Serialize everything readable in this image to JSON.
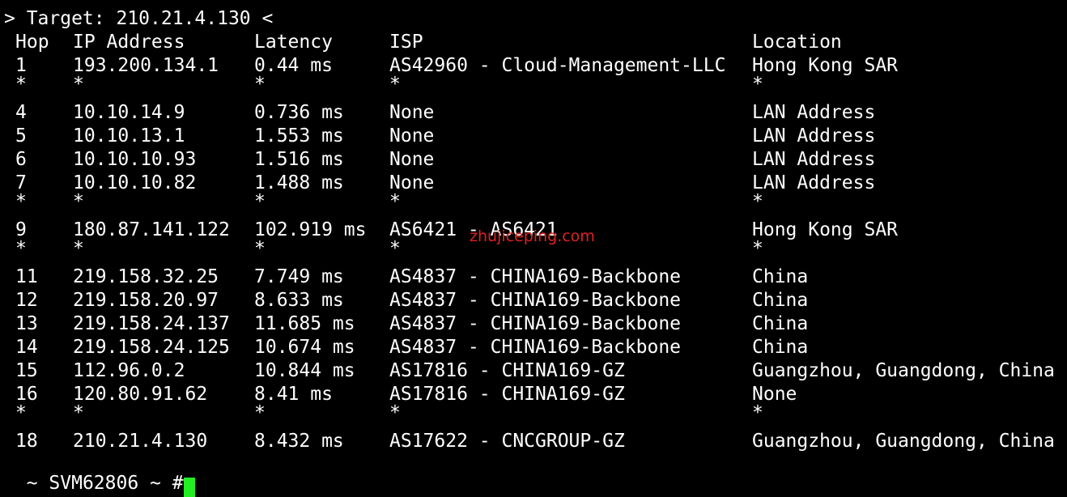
{
  "terminal": {
    "target_line": "> Target: 210.21.4.130 <",
    "headers": {
      "hop": "Hop",
      "ip": "IP Address",
      "latency": "Latency",
      "isp": "ISP",
      "location": "Location"
    },
    "rows": [
      {
        "hop": "1",
        "ip": "193.200.134.1",
        "latency": "0.44 ms",
        "isp": "AS42960 - Cloud-Management-LLC",
        "location": "Hong Kong SAR"
      },
      {
        "hop": "*",
        "ip": "*",
        "latency": "*",
        "isp": "*",
        "location": "*"
      },
      {
        "hop": "4",
        "ip": "10.10.14.9",
        "latency": "0.736 ms",
        "isp": "None",
        "location": "LAN Address"
      },
      {
        "hop": "5",
        "ip": "10.10.13.1",
        "latency": "1.553 ms",
        "isp": "None",
        "location": "LAN Address"
      },
      {
        "hop": "6",
        "ip": "10.10.10.93",
        "latency": "1.516 ms",
        "isp": "None",
        "location": "LAN Address"
      },
      {
        "hop": "7",
        "ip": "10.10.10.82",
        "latency": "1.488 ms",
        "isp": "None",
        "location": "LAN Address"
      },
      {
        "hop": "*",
        "ip": "*",
        "latency": "*",
        "isp": "*",
        "location": "*"
      },
      {
        "hop": "9",
        "ip": "180.87.141.122",
        "latency": "102.919 ms",
        "isp": "AS6421 - AS6421",
        "location": "Hong Kong SAR"
      },
      {
        "hop": "*",
        "ip": "*",
        "latency": "*",
        "isp": "*",
        "location": "*"
      },
      {
        "hop": "11",
        "ip": "219.158.32.25",
        "latency": "7.749 ms",
        "isp": "AS4837 - CHINA169-Backbone",
        "location": "China"
      },
      {
        "hop": "12",
        "ip": "219.158.20.97",
        "latency": "8.633 ms",
        "isp": "AS4837 - CHINA169-Backbone",
        "location": "China"
      },
      {
        "hop": "13",
        "ip": "219.158.24.137",
        "latency": "11.685 ms",
        "isp": "AS4837 - CHINA169-Backbone",
        "location": "China"
      },
      {
        "hop": "14",
        "ip": "219.158.24.125",
        "latency": "10.674 ms",
        "isp": "AS4837 - CHINA169-Backbone",
        "location": "China"
      },
      {
        "hop": "15",
        "ip": "112.96.0.2",
        "latency": "10.844 ms",
        "isp": "AS17816 - CHINA169-GZ",
        "location": "Guangzhou, Guangdong, China"
      },
      {
        "hop": "16",
        "ip": "120.80.91.62",
        "latency": "8.41 ms",
        "isp": "AS17816 - CHINA169-GZ",
        "location": "None"
      },
      {
        "hop": "*",
        "ip": "*",
        "latency": "*",
        "isp": "*",
        "location": "*"
      },
      {
        "hop": "18",
        "ip": "210.21.4.130",
        "latency": "8.432 ms",
        "isp": "AS17622 - CNCGROUP-GZ",
        "location": "Guangzhou, Guangdong, China"
      }
    ],
    "watermark": "zhujiceping.com",
    "prompt": "~ SVM62806 ~ #",
    "colors": {
      "background": "#000000",
      "text": "#ffffff",
      "watermark": "#e02020",
      "cursor": "#22ee22"
    }
  }
}
